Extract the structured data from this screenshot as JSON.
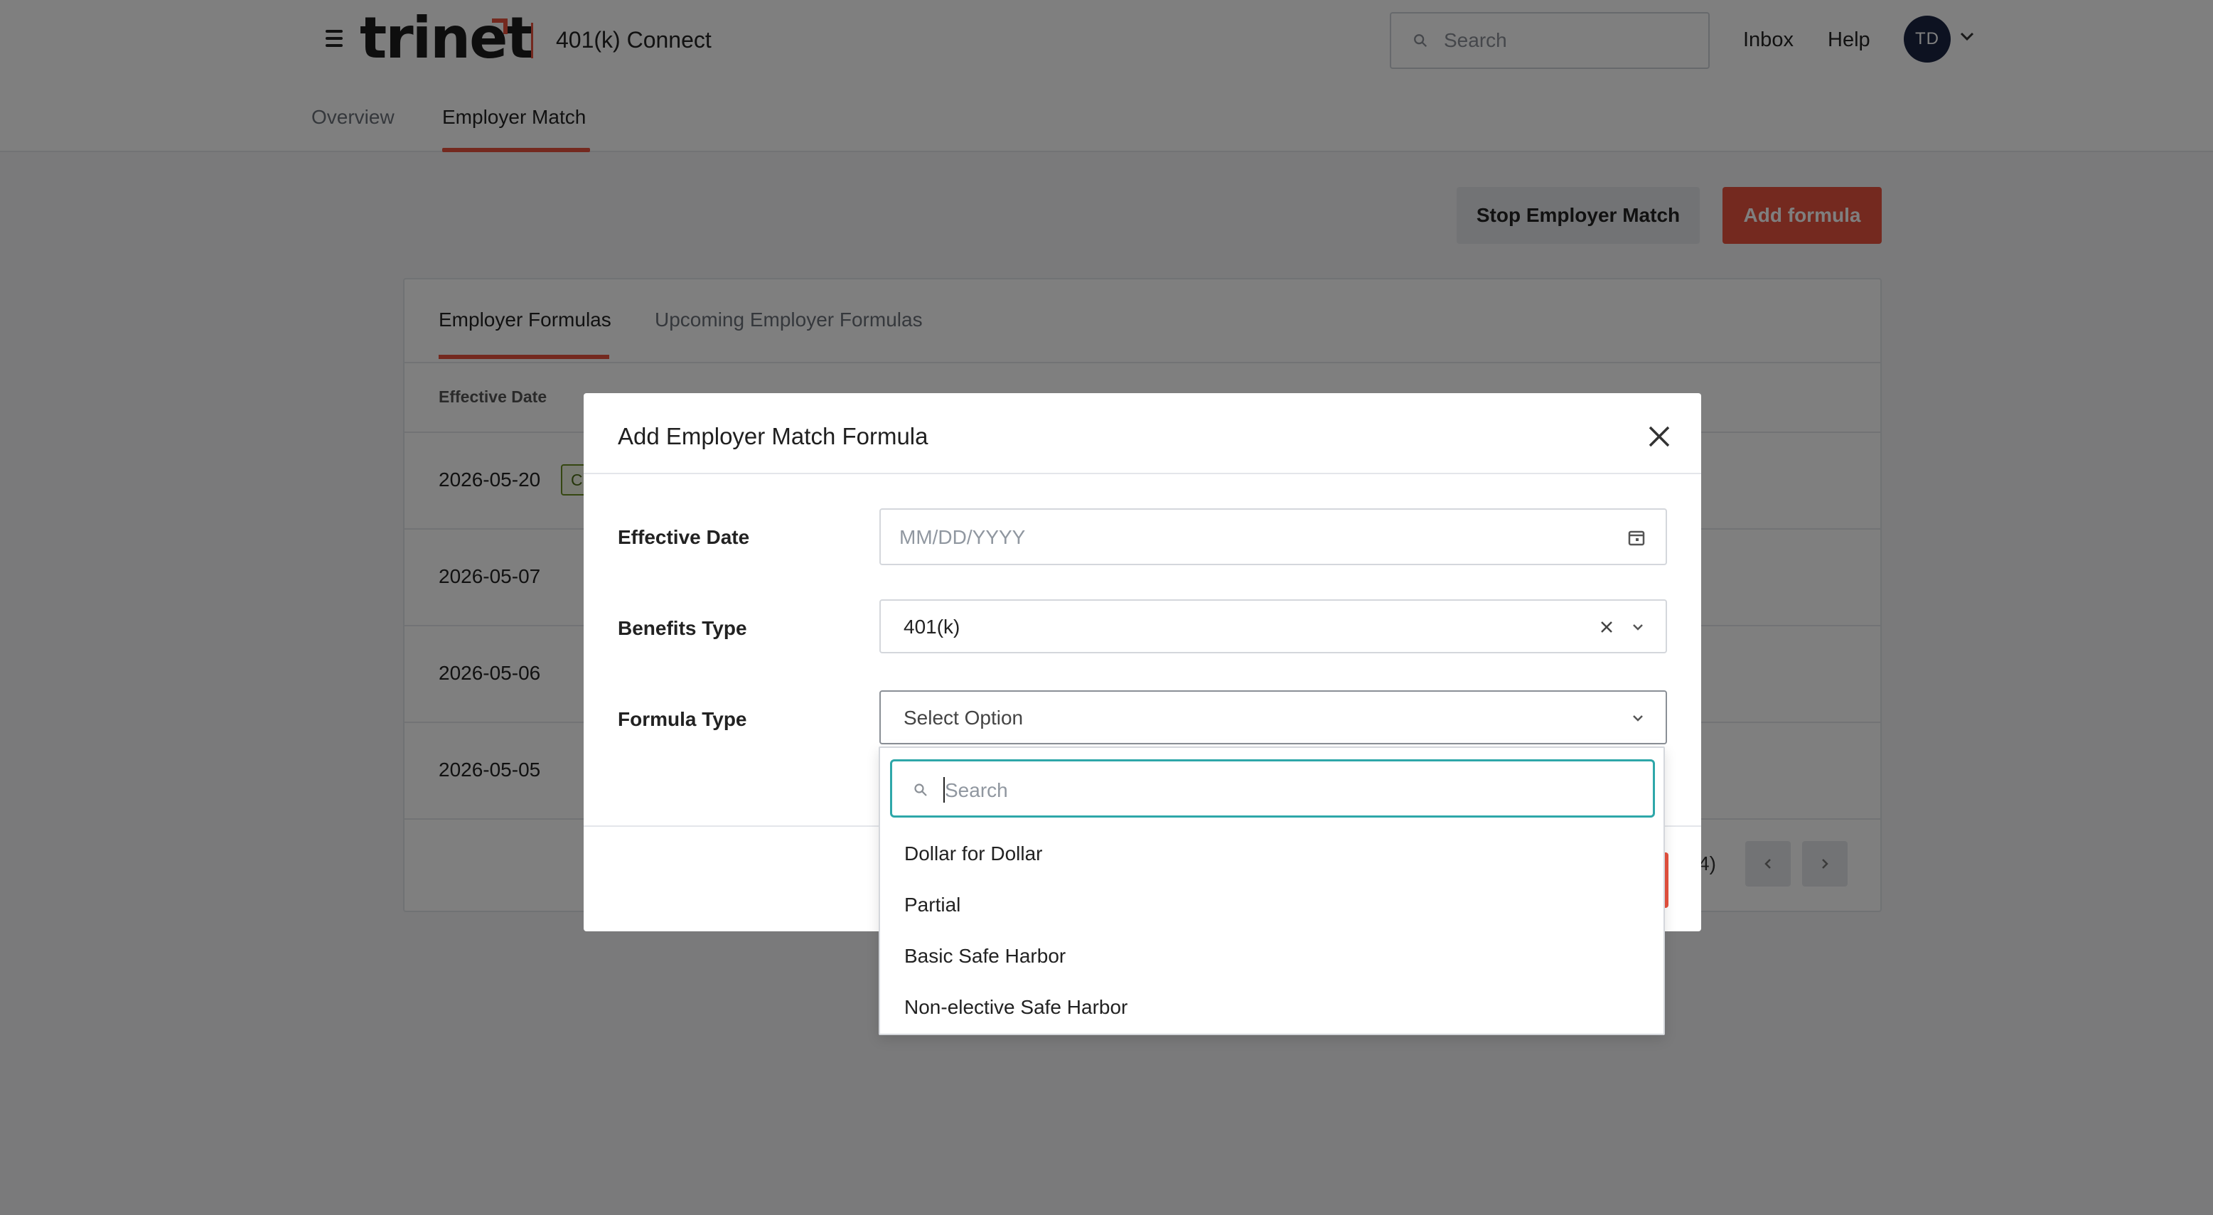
{
  "header": {
    "logo_text": "trinet",
    "app_name": "401(k) Connect",
    "search_placeholder": "Search",
    "links": [
      "Inbox",
      "Help"
    ],
    "avatar_initials": "TD"
  },
  "nav": {
    "tabs": [
      "Overview",
      "Employer Match"
    ],
    "active_tab": "Employer Match"
  },
  "actions": {
    "stop_label": "Stop Employer Match",
    "add_label": "Add formula"
  },
  "formulas_card": {
    "tabs": [
      "Employer Formulas",
      "Upcoming Employer Formulas"
    ],
    "columns": [
      "Effective Date"
    ],
    "rows": [
      {
        "date": "2026-05-20",
        "badge": "Cu"
      },
      {
        "date": "2026-05-07"
      },
      {
        "date": "2026-05-06"
      },
      {
        "date": "2026-05-05"
      }
    ],
    "pager_text": "4)"
  },
  "modal": {
    "title": "Add Employer Match Formula",
    "fields": {
      "effective_date": {
        "label": "Effective Date",
        "placeholder": "MM/DD/YYYY"
      },
      "benefits_type": {
        "label": "Benefits Type",
        "value": "401(k)"
      },
      "formula_type": {
        "label": "Formula Type",
        "placeholder": "Select Option"
      }
    }
  },
  "dropdown": {
    "search_placeholder": "Search",
    "options": [
      "Dollar for Dollar",
      "Partial",
      "Basic Safe Harbor",
      "Non-elective Safe Harbor"
    ]
  },
  "colors": {
    "accent": "#e8523f",
    "avatar_bg": "#1b2443",
    "focus_ring": "#2ea7a9"
  }
}
